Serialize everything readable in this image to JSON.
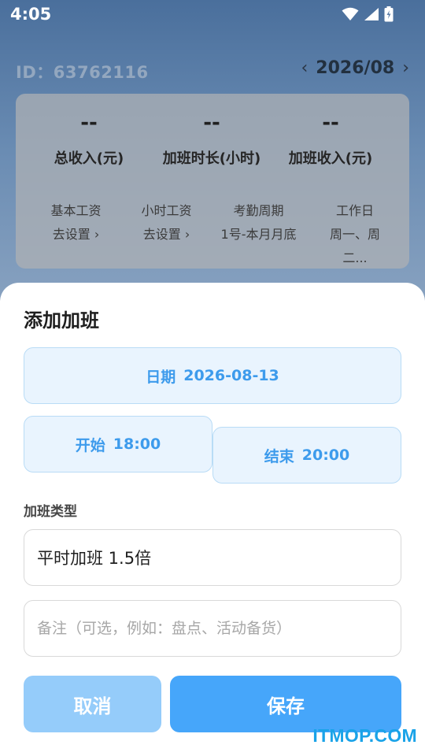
{
  "status_bar": {
    "time": "4:05"
  },
  "header": {
    "user_id": "ID：63762116",
    "prev_arrow": "‹",
    "month": "2026/08",
    "next_arrow": "›"
  },
  "summary": {
    "stats": [
      {
        "value": "--",
        "label": "总收入(元)"
      },
      {
        "value": "--",
        "label": "加班时长(小时)"
      },
      {
        "value": "--",
        "label": "加班收入(元)"
      }
    ],
    "settings": [
      {
        "label": "基本工资",
        "value": "去设置 ›"
      },
      {
        "label": "小时工资",
        "value": "去设置 ›"
      },
      {
        "label": "考勤周期",
        "value": "1号-本月月底"
      },
      {
        "label": "工作日",
        "value": "周一、周二..."
      }
    ]
  },
  "sheet": {
    "title": "添加加班",
    "date": {
      "label": "日期",
      "value": "2026-08-13"
    },
    "start": {
      "label": "开始",
      "value": "18:00"
    },
    "end": {
      "label": "结束",
      "value": "20:00"
    },
    "type_label": "加班类型",
    "type_value": "平时加班 1.5倍",
    "note_placeholder": "备注（可选，例如：盘点、活动备货）",
    "cancel_label": "取消",
    "save_label": "保存"
  },
  "watermark": "ITMOP.COM",
  "colors": {
    "accent": "#46a6fa",
    "accent_light": "#95ccfa",
    "pill_bg": "#e9f4fe",
    "pill_text": "#3d9bec"
  },
  "icons": [
    "wifi-icon",
    "signal-icon",
    "battery-charging-icon"
  ]
}
